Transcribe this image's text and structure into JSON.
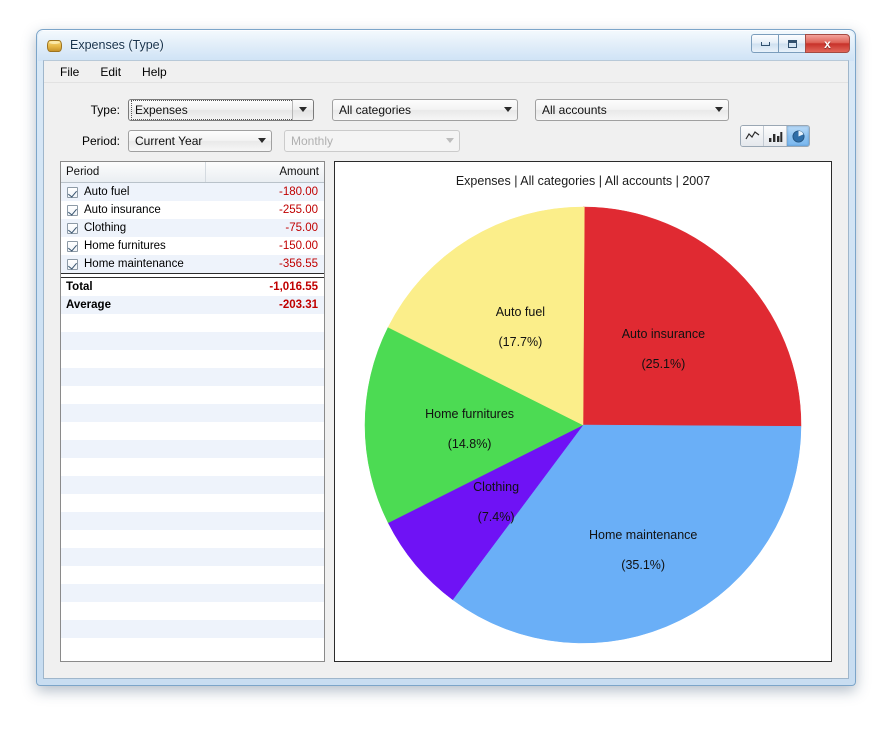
{
  "window": {
    "title": "Expenses (Type)",
    "icon": "money-bag-icon",
    "minimize_label": "Minimize",
    "maximize_label": "Maximize",
    "close_label": "x"
  },
  "menu": {
    "items": [
      {
        "label": "File"
      },
      {
        "label": "Edit"
      },
      {
        "label": "Help"
      }
    ]
  },
  "filters": {
    "type_label": "Type:",
    "type_value": "Expenses",
    "category_value": "All categories",
    "account_value": "All accounts",
    "period_label": "Period:",
    "period_value": "Current Year",
    "interval_value": "Monthly",
    "interval_enabled": false,
    "chart_types": [
      {
        "name": "line-chart-toggle",
        "label": "Line chart",
        "active": false
      },
      {
        "name": "bar-chart-toggle",
        "label": "Bar chart",
        "active": false
      },
      {
        "name": "pie-chart-toggle",
        "label": "Pie chart",
        "active": true
      }
    ]
  },
  "table": {
    "columns": [
      "Period",
      "Amount"
    ],
    "rows": [
      {
        "label": "Auto fuel",
        "amount": "-180.00",
        "checked": true
      },
      {
        "label": "Auto insurance",
        "amount": "-255.00",
        "checked": true
      },
      {
        "label": "Clothing",
        "amount": "-75.00",
        "checked": true
      },
      {
        "label": "Home furnitures",
        "amount": "-150.00",
        "checked": true
      },
      {
        "label": "Home maintenance",
        "amount": "-356.55",
        "checked": true
      }
    ],
    "summary": [
      {
        "label": "Total",
        "amount": "-1,016.55"
      },
      {
        "label": "Average",
        "amount": "-203.31"
      }
    ]
  },
  "chart_data": {
    "type": "pie",
    "title": "Expenses | All categories | All accounts | 2007",
    "categories": [
      "Auto insurance",
      "Home maintenance",
      "Clothing",
      "Home furnitures",
      "Auto fuel"
    ],
    "values": [
      255.0,
      356.55,
      75.0,
      150.0,
      180.0
    ],
    "percentages": [
      25.1,
      35.1,
      7.4,
      14.8,
      17.7
    ],
    "percent_labels": [
      "(25.1%)",
      "(35.1%)",
      "(7.4%)",
      "(14.8%)",
      "(17.7%)"
    ],
    "colors": [
      "#e02a32",
      "#6aaff7",
      "#6f12f5",
      "#4cdb53",
      "#fbee8a"
    ],
    "start_angle_deg": 0,
    "direction": "clockwise",
    "legend": "none",
    "total": 1016.55,
    "xlabel": "",
    "ylabel": ""
  },
  "colors": {
    "accent": "#6aaff7",
    "negative_amount": "#c00000",
    "title_text": "#18334d"
  }
}
